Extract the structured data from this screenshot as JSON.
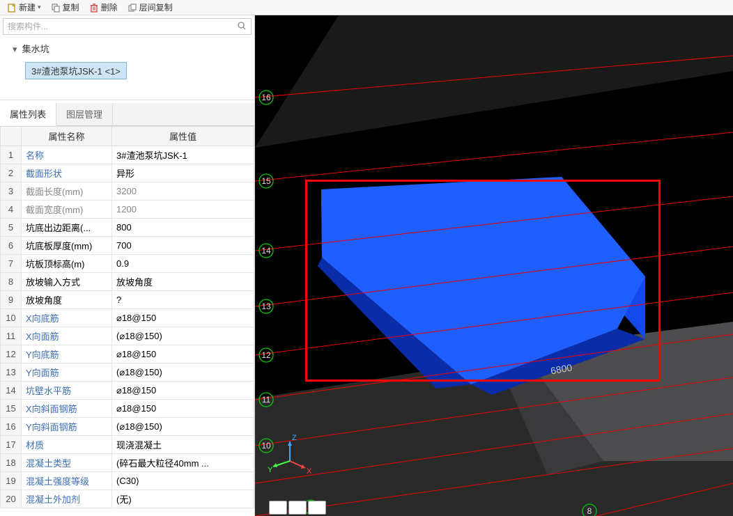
{
  "toolbar": {
    "new": "新建",
    "copy": "复制",
    "delete": "删除",
    "layer_copy": "层间复制"
  },
  "search": {
    "placeholder": "搜索构件..."
  },
  "tree": {
    "root": "集水坑",
    "selected": "3#渣池泵坑JSK-1 <1>"
  },
  "tabs": {
    "properties": "属性列表",
    "layer": "图层管理"
  },
  "table": {
    "headers": {
      "name": "属性名称",
      "value": "属性值"
    },
    "rows": [
      {
        "n": "1",
        "name": "名称",
        "value": "3#渣池泵坑JSK-1",
        "link": true
      },
      {
        "n": "2",
        "name": "截面形状",
        "value": "异形",
        "link": true
      },
      {
        "n": "3",
        "name": "截面长度(mm)",
        "value": "3200",
        "gray": true
      },
      {
        "n": "4",
        "name": "截面宽度(mm)",
        "value": "1200",
        "gray": true
      },
      {
        "n": "5",
        "name": "坑底出边距离(...",
        "value": "800"
      },
      {
        "n": "6",
        "name": "坑底板厚度(mm)",
        "value": "700"
      },
      {
        "n": "7",
        "name": "坑板顶标高(m)",
        "value": "0.9"
      },
      {
        "n": "8",
        "name": "放坡输入方式",
        "value": "放坡角度"
      },
      {
        "n": "9",
        "name": "放坡角度",
        "value": "?"
      },
      {
        "n": "10",
        "name": "X向底筋",
        "value": "⌀18@150",
        "link": true
      },
      {
        "n": "11",
        "name": "X向面筋",
        "value": "(⌀18@150)",
        "link": true
      },
      {
        "n": "12",
        "name": "Y向底筋",
        "value": "⌀18@150",
        "link": true
      },
      {
        "n": "13",
        "name": "Y向面筋",
        "value": "(⌀18@150)",
        "link": true
      },
      {
        "n": "14",
        "name": "坑壁水平筋",
        "value": "⌀18@150",
        "link": true
      },
      {
        "n": "15",
        "name": "X向斜面钢筋",
        "value": "⌀18@150",
        "link": true
      },
      {
        "n": "16",
        "name": "Y向斜面钢筋",
        "value": "(⌀18@150)",
        "link": true
      },
      {
        "n": "17",
        "name": "材质",
        "value": "现浇混凝土",
        "link": true
      },
      {
        "n": "18",
        "name": "混凝土类型",
        "value": "(碎石最大粒径40mm ...",
        "link": true
      },
      {
        "n": "19",
        "name": "混凝土强度等级",
        "value": "(C30)",
        "link": true
      },
      {
        "n": "20",
        "name": "混凝土外加剂",
        "value": "(无)",
        "link": true
      }
    ]
  },
  "viewport": {
    "axis_labels": [
      "16",
      "15",
      "14",
      "13",
      "12",
      "11",
      "10",
      "9",
      "8"
    ],
    "dim": "6800",
    "gizmo": {
      "x": "X",
      "y": "Y",
      "z": "Z"
    }
  }
}
